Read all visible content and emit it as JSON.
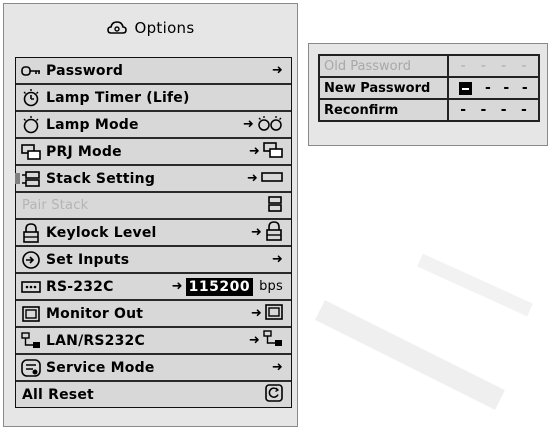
{
  "menu": {
    "title": "Options",
    "items": [
      {
        "label": "Password",
        "right_arrow": "➜"
      },
      {
        "label": "Lamp Timer (Life)"
      },
      {
        "label": "Lamp Mode",
        "right_arrow": "➜"
      },
      {
        "label": "PRJ Mode",
        "right_arrow": "➜"
      },
      {
        "label": "Stack Setting",
        "right_arrow": "➜"
      },
      {
        "label": "Pair Stack"
      },
      {
        "label": "Keylock Level",
        "right_arrow": "➜"
      },
      {
        "label": "Set Inputs",
        "right_arrow": "➜"
      },
      {
        "label": "RS-232C",
        "right_arrow": "➜",
        "value": "115200",
        "unit": "bps"
      },
      {
        "label": "Monitor Out",
        "right_arrow": "➜"
      },
      {
        "label": "LAN/RS232C",
        "right_arrow": "➜"
      },
      {
        "label": "Service Mode",
        "right_arrow": "➜"
      },
      {
        "label": "All Reset"
      }
    ]
  },
  "password_panel": {
    "rows": [
      {
        "label": "Old Password",
        "chars": [
          "-",
          "-",
          "-",
          "-"
        ]
      },
      {
        "label": "New Password",
        "chars": [
          "-",
          "-",
          "-"
        ]
      },
      {
        "label": "Reconfirm",
        "chars": [
          "-",
          "-",
          "-",
          "-"
        ]
      }
    ]
  }
}
